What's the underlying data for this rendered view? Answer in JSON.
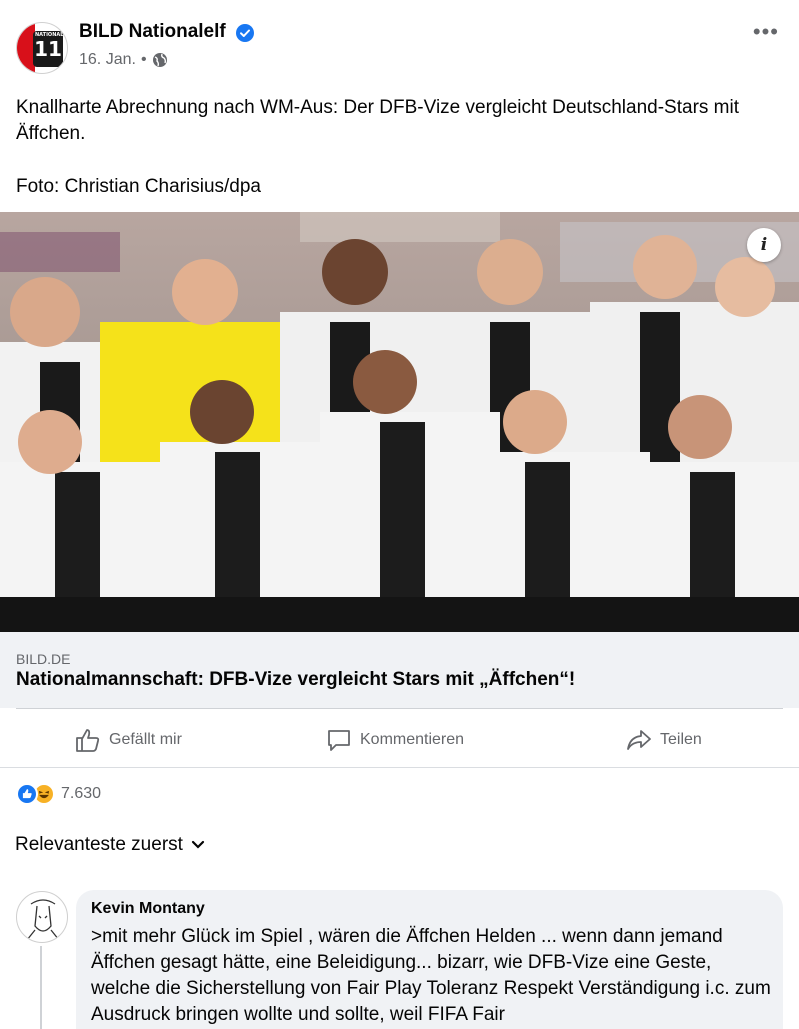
{
  "post": {
    "page_name": "BILD Nationalelf",
    "avatar_text": "11",
    "avatar_small": "NATIONAL",
    "date": "16. Jan.",
    "separator": "•",
    "text": "Knallharte Abrechnung nach WM-Aus: Der DFB-Vize vergleicht Deutschland-Stars mit Äffchen.",
    "credit": "Foto: Christian Charisius/dpa",
    "info_label": "i"
  },
  "link": {
    "domain": "BILD.DE",
    "title": "Nationalmannschaft: DFB-Vize vergleicht Stars mit „Äffchen“!"
  },
  "actions": {
    "like": "Gefällt mir",
    "comment": "Kommentieren",
    "share": "Teilen"
  },
  "reactions": {
    "count": "7.630"
  },
  "sort": {
    "label": "Relevanteste zuerst"
  },
  "comment": {
    "author": "Kevin Montany",
    "text": ">mit mehr Glück im Spiel , wären die Äffchen Helden ... wenn dann jemand Äffchen gesagt hätte, eine Beleidigung... bizarr, wie DFB-Vize eine Geste, welche die Sicherstellung von Fair Play Toleranz Respekt Verständigung i.c. zum Ausdruck bringen wollte und sollte, weil FIFA Fair"
  },
  "colors": {
    "brand_blue": "#1877f2",
    "secondary_text": "#65676b",
    "bubble_bg": "#f0f2f5"
  }
}
